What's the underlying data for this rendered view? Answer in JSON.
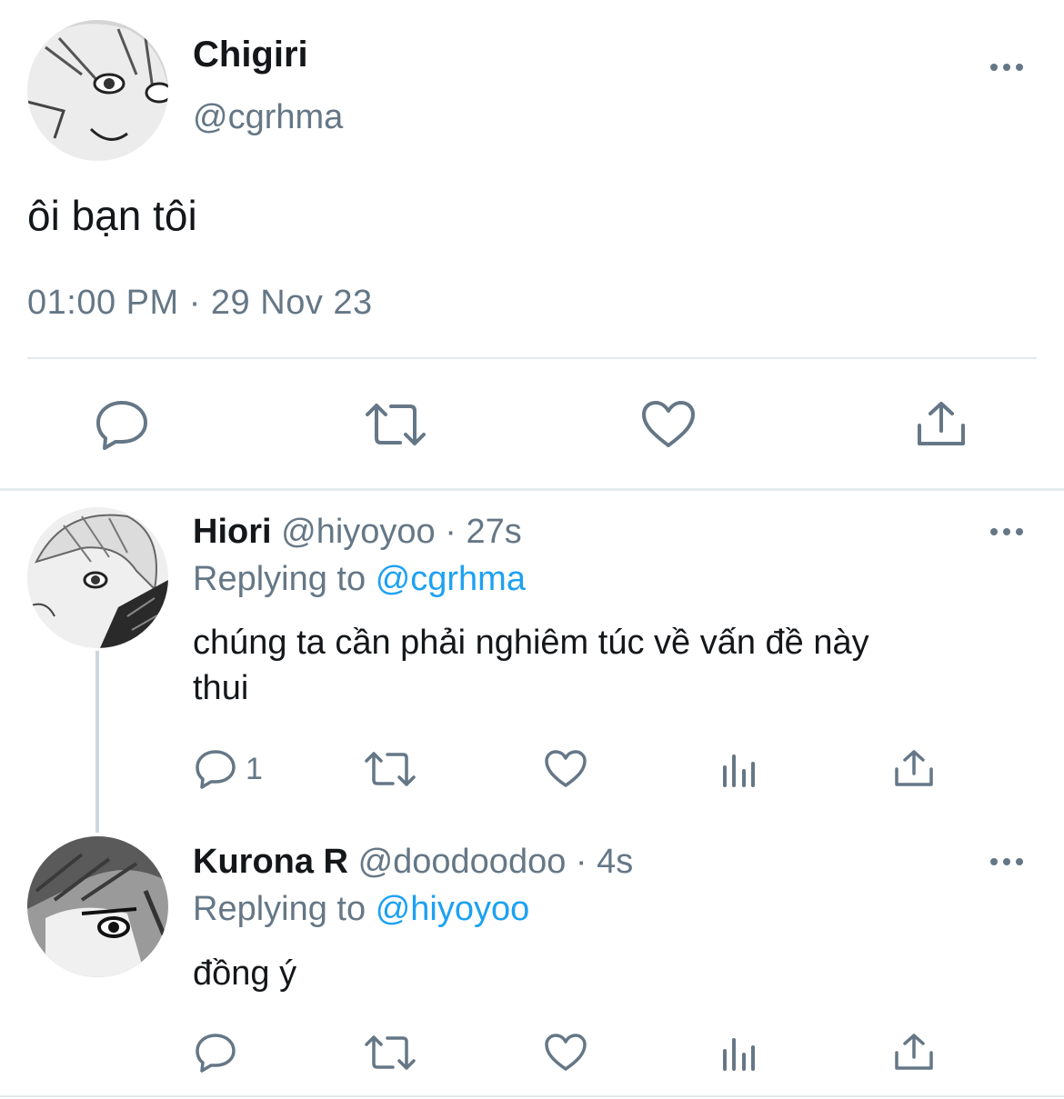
{
  "main_tweet": {
    "display_name": "Chigiri",
    "handle": "@cgrhma",
    "text": "ôi bạn tôi",
    "timestamp": "01:00 PM · 29 Nov 23",
    "actions": [
      "reply-icon",
      "retweet-icon",
      "like-icon",
      "share-icon"
    ]
  },
  "replies": [
    {
      "display_name": "Hiori",
      "handle": "@hiyoyoo",
      "time": "· 27s",
      "replying_prefix": "Replying to",
      "replying_to": "@cgrhma",
      "text_line1": "chúng ta cần phải nghiêm túc về vấn đề này",
      "text_line2": "thui",
      "reply_count": "1"
    },
    {
      "display_name": "Kurona R",
      "handle": "@doodoodoo",
      "time": "· 4s",
      "replying_prefix": "Replying to",
      "replying_to": "@hiyoyoo",
      "text_line1": "đồng ý",
      "reply_count": ""
    }
  ],
  "colors": {
    "secondary_text": "#657786",
    "mention": "#1da1f2",
    "icon": "#657786",
    "divider": "#e1e8ed"
  }
}
